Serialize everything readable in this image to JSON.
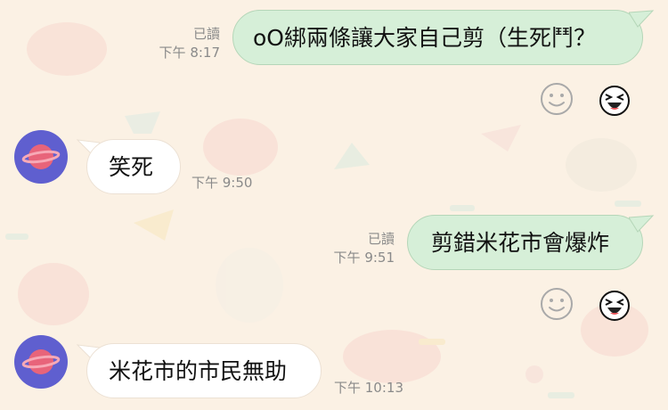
{
  "messages": [
    {
      "type": "outgoing",
      "text": "oO綁兩條讓大家自己剪（生死鬥？",
      "read": "已讀",
      "time": "下午 8:17"
    },
    {
      "type": "incoming",
      "text": "笑死",
      "time": "下午 9:50"
    },
    {
      "type": "outgoing",
      "text": "剪錯米花市會爆炸",
      "read": "已讀",
      "time": "下午 9:51"
    },
    {
      "type": "incoming",
      "text": "米花市的市民無助",
      "time": "下午 10:13"
    }
  ],
  "icons": {
    "avatar": "planet-avatar-icon",
    "add_reaction": "smiley-outline-icon",
    "reaction": "laughing-face-icon"
  },
  "colors": {
    "background": "#fbf1e4",
    "outgoing_bubble": "#d6efd8",
    "incoming_bubble": "#ffffff",
    "avatar": "#5f5fcf",
    "planet": "#e8647a"
  }
}
